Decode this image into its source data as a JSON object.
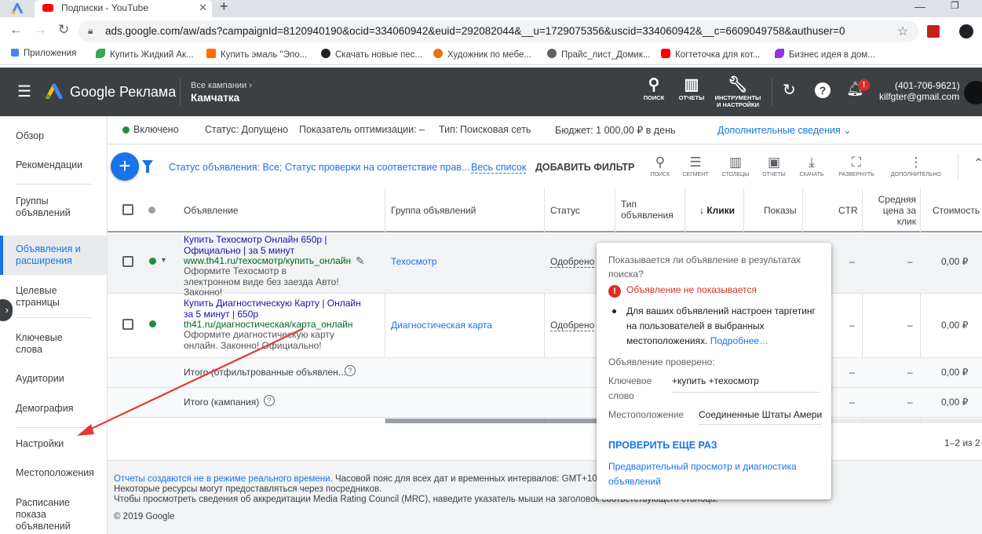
{
  "browser": {
    "tab_ads_label": "",
    "tab_youtube_label": "Подписки - YouTube",
    "url": "ads.google.com/aw/ads?campaignId=8120940190&ocid=334060942&euid=292082044&__u=1729075356&uscid=334060942&__c=6609049758&authuser=0",
    "bookmarks": [
      "Приложения",
      "Купить Жидкий Ак...",
      "Купить эмаль \"Эпо...",
      "Скачать новые пес...",
      "Художник по мебе...",
      "Прайс_лист_Домик...",
      "Когтеточка для кот...",
      "Бизнес идея в дом..."
    ]
  },
  "header": {
    "product": "Google Реклама",
    "crumb_top": "Все кампании",
    "crumb_main": "Камчатка",
    "search_label": "ПОИСК",
    "reports_label": "ОТЧЕТЫ",
    "tools_label_1": "ИНСТРУМЕНТЫ",
    "tools_label_2": "И НАСТРОЙКИ",
    "notif_badge": "!",
    "account_phone": "(401-706-9621)",
    "account_email": "kilfgter@gmail.com"
  },
  "sidebar": {
    "items": [
      "Обзор",
      "Рекомендации",
      "Группы объявлений",
      "Объявления и расширения",
      "Целевые страницы",
      "Ключевые слова",
      "Аудитории",
      "Демография",
      "Настройки",
      "Местоположения",
      "Расписание показа объявлений"
    ]
  },
  "statusbar": {
    "state": "Включено",
    "status": "Статус: Допущено",
    "optimization": "Показатель оптимизации: –",
    "type_label": "Тип:",
    "type_value": "Поисковая сеть",
    "budget": "Бюджет: 1 000,00 ₽ в день",
    "more": "Дополнительные сведения"
  },
  "toolbar": {
    "filter_text": "Статус объявления: Все; Статус проверки на соответствие прав...",
    "view_all": "Весь список",
    "add_filter": "ДОБАВИТЬ ФИЛЬТР",
    "tools": [
      "ПОИСК",
      "СЕГМЕНТ",
      "СТОЛБЦЫ",
      "ОТЧЕТЫ",
      "СКАЧАТЬ",
      "РАЗВЕРНУТЬ",
      "ДОПОЛНИТЕЛЬНО"
    ]
  },
  "table": {
    "headers": {
      "ad": "Объявление",
      "group": "Группа объявлений",
      "status": "Статус",
      "type": "Тип объявления",
      "clicks": "Клики",
      "impressions": "Показы",
      "ctr": "CTR",
      "avg_price": "Средняя цена за клик",
      "cost": "Стоимость"
    },
    "rows": [
      {
        "title": "Купить Техосмотр Онлайн 650р | Официально | за 5 минут",
        "url": "www.th41.ru/техосмотр/купить_онлайн",
        "desc": "Оформите Техосмотр в электронном виде без заезда Авто! Законно!",
        "group": "Техосмотр",
        "status": "Одобрено",
        "ctr": "–",
        "avg": "–",
        "cost": "0,00 ₽"
      },
      {
        "title": "Купить Диагностическую Карту | Онлайн за 5 минут | 650р",
        "url": "th41.ru/диагностическая/карта_онлайн",
        "desc": "Оформите диагностическую карту онлайн. Законно! Официально!",
        "group": "Диагностическая карта",
        "status": "Одобрено",
        "ctr": "–",
        "avg": "–",
        "cost": "0,00 ₽"
      }
    ],
    "total_filtered": "Итого (отфильтрованные объявлен...",
    "total_campaign": "Итого (кампания)",
    "total_ctr": "–",
    "total_avg": "–",
    "total_cost": "0,00 ₽",
    "pagination": "1–2 из 2"
  },
  "popup": {
    "question": "Показывается ли объявление в результатах поиска?",
    "error": "Объявление не показывается",
    "bullet": "Для ваших объявлений настроен таргетинг на пользователей в выбранных местоположениях.",
    "more_link": "Подробнее…",
    "checked_label": "Объявление проверено:",
    "kw_label": "Ключевое слово",
    "kw_value": "+купить +техосмотр",
    "loc_label": "Местоположение",
    "loc_value": "Соединенные Штаты Амери",
    "recheck": "ПРОВЕРИТЬ ЕЩЕ РАЗ",
    "preview": "Предварительный просмотр и диагностика объявлений"
  },
  "footer": {
    "line1_link": "Отчеты создаются не в режиме реального времени.",
    "line1_rest": "Часовой пояс для всех дат и временных интервалов: GMT+10:0",
    "line2": "Некоторые ресурсы могут предоставляться через посредников.",
    "line3": "Чтобы просмотреть сведения об аккредитации Media Rating Council (MRC), наведите указатель мыши на заголовок соответствующего столбца.",
    "copyright": "© 2019 Google"
  },
  "colors": {
    "accent": "#1a73e8",
    "header_bg": "#3c4043",
    "enabled_green": "#1e8e3e",
    "error_red": "#d93025",
    "arrow_red": "#e53935"
  }
}
